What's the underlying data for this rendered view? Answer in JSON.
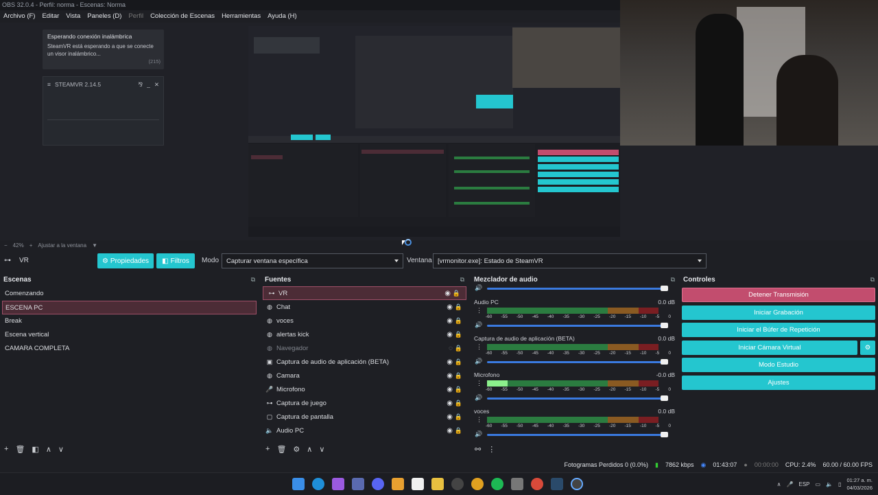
{
  "window": {
    "title": "OBS 32.0.4 - Perfil: norma - Escenas: Norma"
  },
  "menu": [
    "Archivo (F)",
    "Editar",
    "Vista",
    "Paneles (D)",
    "Perfil",
    "Colección de Escenas",
    "Herramientas",
    "Ayuda (H)"
  ],
  "notification": {
    "title": "Esperando conexión inalámbrica",
    "body": "SteamVR está esperando a que se conecte un visor inalámbrico...",
    "count": "(215)"
  },
  "steamvr": {
    "title": "STEAMVR 2.14.5"
  },
  "zoom": {
    "percent": "42%",
    "fit_label": "Ajustar a la ventana"
  },
  "source_bar": {
    "current": "VR",
    "properties": "Propiedades",
    "filters": "Filtros",
    "mode_label": "Modo",
    "mode_value": "Capturar ventana específica",
    "window_label": "Ventana",
    "window_value": "[vrmonitor.exe]: Estado de SteamVR"
  },
  "scenes": {
    "title": "Escenas",
    "items": [
      "Comenzando",
      "ESCENA PC",
      "Break",
      "Escena vertical",
      "CAMARA COMPLETA"
    ],
    "selected": 1
  },
  "sources": {
    "title": "Fuentes",
    "items": [
      {
        "name": "VR",
        "icon": "vr-headset-icon"
      },
      {
        "name": "Chat",
        "icon": "globe-icon"
      },
      {
        "name": "voces",
        "icon": "globe-icon"
      },
      {
        "name": "alertas kick",
        "icon": "globe-icon"
      },
      {
        "name": "Navegador",
        "icon": "globe-icon"
      },
      {
        "name": "Captura de audio de aplicación (BETA)",
        "icon": "app-audio-icon"
      },
      {
        "name": "Camara",
        "icon": "camera-icon"
      },
      {
        "name": "Microfono",
        "icon": "microphone-icon"
      },
      {
        "name": "Captura de juego",
        "icon": "gamepad-icon"
      },
      {
        "name": "Captura de pantalla",
        "icon": "monitor-icon"
      },
      {
        "name": "Audio PC",
        "icon": "speaker-icon"
      }
    ]
  },
  "mixer": {
    "title": "Mezclador de audio",
    "scale": [
      "-60",
      "-55",
      "-50",
      "-45",
      "-40",
      "-35",
      "-30",
      "-25",
      "-20",
      "-15",
      "-10",
      "-5",
      "0"
    ],
    "channels": [
      {
        "name": "Audio PC",
        "db": "0.0 dB",
        "level": 0.0
      },
      {
        "name": "Captura de audio de aplicación (BETA)",
        "db": "0.0 dB",
        "level": 0.0
      },
      {
        "name": "Microfono",
        "db": "-0.0 dB",
        "level": 0.12
      },
      {
        "name": "voces",
        "db": "0.0 dB",
        "level": 0.0
      }
    ]
  },
  "controls": {
    "title": "Controles",
    "stop_stream": "Detener Transmisión",
    "start_record": "Iniciar Grabación",
    "start_replay": "Iniciar el Búfer de Repetición",
    "start_vcam": "Iniciar Cámara Virtual",
    "studio": "Modo Estudio",
    "settings": "Ajustes"
  },
  "status": {
    "dropped": "Fotogramas Perdidos 0 (0.0%)",
    "kbps": "7862 kbps",
    "stream_time": "01:43:07",
    "rec_time": "00:00:00",
    "cpu": "CPU: 2.4%",
    "fps": "60.00 / 60.00 FPS"
  },
  "taskbar": {
    "lang": "ESP",
    "time": "01:27 a. m.",
    "date": "04/03/2026"
  },
  "colors": {
    "accent": "#24c6cf",
    "stop": "#c24d6e",
    "meter_green": "#2b7c40"
  }
}
